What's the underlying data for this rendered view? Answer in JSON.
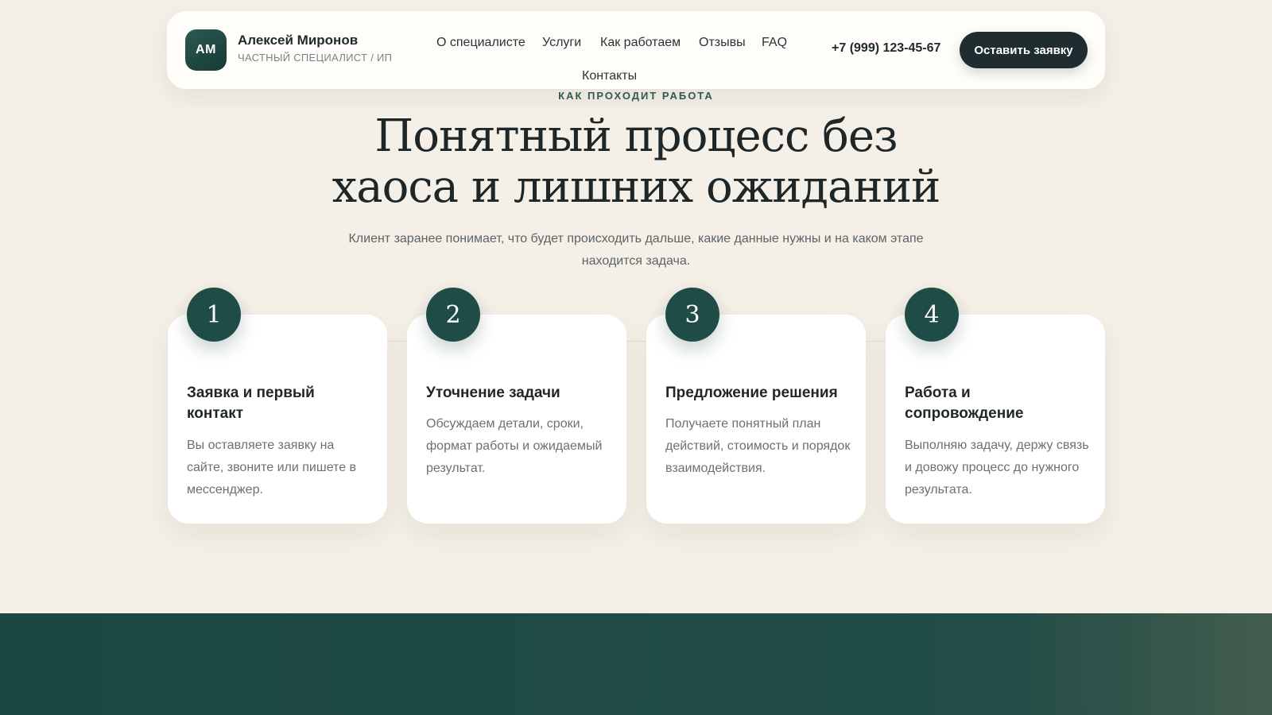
{
  "header": {
    "logo_initials": "АМ",
    "brand_name": "Алексей Миронов",
    "brand_subtitle": "ЧАСТНЫЙ СПЕЦИАЛИСТ / ИП",
    "nav": [
      {
        "label": "О специалисте"
      },
      {
        "label": "Услуги"
      },
      {
        "label": "Как работаем"
      },
      {
        "label": "Отзывы"
      },
      {
        "label": "FAQ"
      },
      {
        "label": "Контакты"
      }
    ],
    "phone": "+7 (999) 123-45-67",
    "cta_label": "Оставить заявку"
  },
  "section": {
    "eyebrow": "КАК ПРОХОДИТ РАБОТА",
    "title_line1": "Понятный процесс без",
    "title_line2": "хаоса и лишних ожиданий",
    "subtitle": "Клиент заранее понимает, что будет происходить дальше, какие данные нужны и на каком этапе находится задача."
  },
  "steps": [
    {
      "number": "1",
      "title": "Заявка и первый контакт",
      "text": "Вы оставляете заявку на сайте, звоните или пишете в мессенджер."
    },
    {
      "number": "2",
      "title": "Уточнение задачи",
      "text": "Обсуждаем детали, сроки, формат работы и ожидаемый результат."
    },
    {
      "number": "3",
      "title": "Предложение решения",
      "text": "Получаете понятный план действий, стоимость и порядок взаимодействия."
    },
    {
      "number": "4",
      "title": "Работа и сопровождение",
      "text": "Выполняю задачу, держу связь и довожу процесс до нужного результата."
    }
  ],
  "colors": {
    "page_background": "#f4efe7",
    "accent_dark_green": "#1f4c47",
    "button_dark": "#1f2d31",
    "eyebrow_green": "#2d5b54"
  }
}
